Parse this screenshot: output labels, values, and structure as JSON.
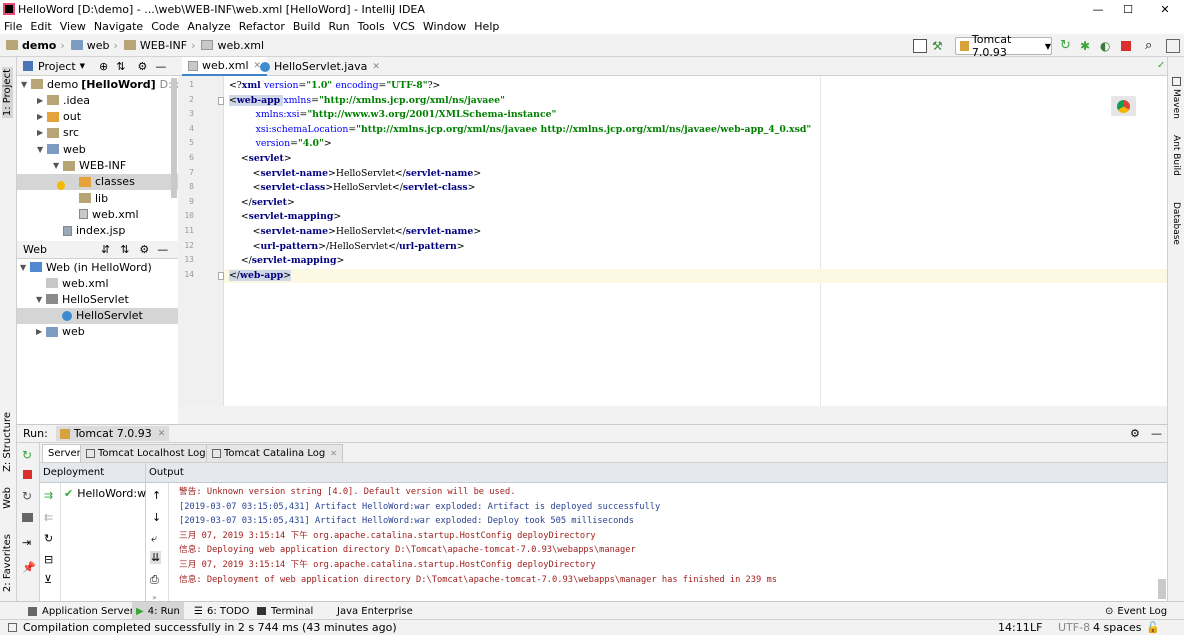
{
  "window": {
    "title": "HelloWord [D:\\demo] - ...\\web\\WEB-INF\\web.xml [HelloWord] - IntelliJ IDEA",
    "controls": {
      "minimize": "—",
      "maximize": "☐",
      "close": "✕"
    }
  },
  "menu": [
    "File",
    "Edit",
    "View",
    "Navigate",
    "Code",
    "Analyze",
    "Refactor",
    "Build",
    "Run",
    "Tools",
    "VCS",
    "Window",
    "Help"
  ],
  "breadcrumb": [
    "demo",
    "web",
    "WEB-INF",
    "web.xml"
  ],
  "run_config": {
    "label": "Tomcat 7.0.93"
  },
  "left_tool_windows": {
    "project": "1: Project",
    "structure": "Z: Structure",
    "web": "Web",
    "favorites": "2: Favorites"
  },
  "right_tool_windows": [
    "Maven",
    "Ant Build",
    "Database"
  ],
  "project_panel": {
    "title": "Project",
    "tree": [
      {
        "label": "demo",
        "bold_suffix": "[HelloWord]",
        "suffix": "D:\\demo",
        "level": 0,
        "expanded": true,
        "icon": "folder-icon"
      },
      {
        "label": ".idea",
        "level": 1,
        "expanded": false,
        "icon": "folder-icon"
      },
      {
        "label": "out",
        "level": 1,
        "expanded": false,
        "icon": "folder-orange-icon"
      },
      {
        "label": "src",
        "level": 1,
        "expanded": false,
        "icon": "folder-icon"
      },
      {
        "label": "web",
        "level": 1,
        "expanded": true,
        "icon": "folder-blue-icon"
      },
      {
        "label": "WEB-INF",
        "level": 2,
        "expanded": true,
        "icon": "folder-icon"
      },
      {
        "label": "classes",
        "level": 3,
        "expanded": null,
        "icon": "folder-orange-icon",
        "selected": true
      },
      {
        "label": "lib",
        "level": 3,
        "expanded": null,
        "icon": "folder-icon"
      },
      {
        "label": "web.xml",
        "level": 3,
        "expanded": null,
        "icon": "xml-file-icon"
      },
      {
        "label": "index.jsp",
        "level": 2,
        "expanded": null,
        "icon": "jsp-file-icon"
      }
    ]
  },
  "web_panel": {
    "title": "Web",
    "tree": [
      {
        "label": "Web (in HelloWord)",
        "level": 0,
        "expanded": true,
        "icon": "web-icon"
      },
      {
        "label": "web.xml",
        "level": 1,
        "expanded": null,
        "icon": "xml-file-icon"
      },
      {
        "label": "HelloServlet",
        "level": 1,
        "expanded": true,
        "icon": "servlet-icon"
      },
      {
        "label": "HelloServlet",
        "level": 2,
        "expanded": null,
        "icon": "class-icon",
        "selected": true
      },
      {
        "label": "web",
        "level": 1,
        "expanded": false,
        "icon": "folder-blue-icon"
      }
    ]
  },
  "editor": {
    "tabs": [
      {
        "label": "web.xml",
        "active": true
      },
      {
        "label": "HelloServlet.java",
        "active": false
      }
    ],
    "line_numbers": [
      "1",
      "2",
      "3",
      "4",
      "5",
      "6",
      "7",
      "8",
      "9",
      "10",
      "11",
      "12",
      "13",
      "14"
    ],
    "code_lines": [
      [
        {
          "t": "br",
          "v": "<?"
        },
        {
          "t": "tag",
          "v": "xml "
        },
        {
          "t": "attr",
          "v": "version"
        },
        {
          "t": "br",
          "v": "="
        },
        {
          "t": "val",
          "v": "\"1.0\" "
        },
        {
          "t": "attr",
          "v": "encoding"
        },
        {
          "t": "br",
          "v": "="
        },
        {
          "t": "val",
          "v": "\"UTF-8\""
        },
        {
          "t": "br",
          "v": "?>"
        }
      ],
      [
        {
          "t": "br",
          "v": "<"
        },
        {
          "t": "tag",
          "v": "web-app "
        },
        {
          "t": "attr",
          "v": "xmlns"
        },
        {
          "t": "br",
          "v": "="
        },
        {
          "t": "val",
          "v": "\"http://xmlns.jcp.org/xml/ns/javaee\""
        }
      ],
      [
        {
          "t": "txt",
          "v": "         "
        },
        {
          "t": "attr",
          "v": "xmlns:xsi"
        },
        {
          "t": "br",
          "v": "="
        },
        {
          "t": "val",
          "v": "\"http://www.w3.org/2001/XMLSchema-instance\""
        }
      ],
      [
        {
          "t": "txt",
          "v": "         "
        },
        {
          "t": "attr",
          "v": "xsi:schemaLocation"
        },
        {
          "t": "br",
          "v": "="
        },
        {
          "t": "val",
          "v": "\"http://xmlns.jcp.org/xml/ns/javaee http://xmlns.jcp.org/xml/ns/javaee/web-app_4_0.xsd\""
        }
      ],
      [
        {
          "t": "txt",
          "v": "         "
        },
        {
          "t": "attr",
          "v": "version"
        },
        {
          "t": "br",
          "v": "="
        },
        {
          "t": "val",
          "v": "\"4.0\""
        },
        {
          "t": "br",
          "v": ">"
        }
      ],
      [
        {
          "t": "txt",
          "v": "    "
        },
        {
          "t": "br",
          "v": "<"
        },
        {
          "t": "tag",
          "v": "servlet"
        },
        {
          "t": "br",
          "v": ">"
        }
      ],
      [
        {
          "t": "txt",
          "v": "        "
        },
        {
          "t": "br",
          "v": "<"
        },
        {
          "t": "tag",
          "v": "servlet-name"
        },
        {
          "t": "br",
          "v": ">"
        },
        {
          "t": "txt",
          "v": "HelloServlet"
        },
        {
          "t": "br",
          "v": "</"
        },
        {
          "t": "tag",
          "v": "servlet-name"
        },
        {
          "t": "br",
          "v": ">"
        }
      ],
      [
        {
          "t": "txt",
          "v": "        "
        },
        {
          "t": "br",
          "v": "<"
        },
        {
          "t": "tag",
          "v": "servlet-class"
        },
        {
          "t": "br",
          "v": ">"
        },
        {
          "t": "txt",
          "v": "HelloServlet"
        },
        {
          "t": "br",
          "v": "</"
        },
        {
          "t": "tag",
          "v": "servlet-class"
        },
        {
          "t": "br",
          "v": ">"
        }
      ],
      [
        {
          "t": "txt",
          "v": "    "
        },
        {
          "t": "br",
          "v": "</"
        },
        {
          "t": "tag",
          "v": "servlet"
        },
        {
          "t": "br",
          "v": ">"
        }
      ],
      [
        {
          "t": "txt",
          "v": "    "
        },
        {
          "t": "br",
          "v": "<"
        },
        {
          "t": "tag",
          "v": "servlet-mapping"
        },
        {
          "t": "br",
          "v": ">"
        }
      ],
      [
        {
          "t": "txt",
          "v": "        "
        },
        {
          "t": "br",
          "v": "<"
        },
        {
          "t": "tag",
          "v": "servlet-name"
        },
        {
          "t": "br",
          "v": ">"
        },
        {
          "t": "txt",
          "v": "HelloServlet"
        },
        {
          "t": "br",
          "v": "</"
        },
        {
          "t": "tag",
          "v": "servlet-name"
        },
        {
          "t": "br",
          "v": ">"
        }
      ],
      [
        {
          "t": "txt",
          "v": "        "
        },
        {
          "t": "br",
          "v": "<"
        },
        {
          "t": "tag",
          "v": "url-pattern"
        },
        {
          "t": "br",
          "v": ">"
        },
        {
          "t": "txt",
          "v": "/HelloServlet"
        },
        {
          "t": "br",
          "v": "</"
        },
        {
          "t": "tag",
          "v": "url-pattern"
        },
        {
          "t": "br",
          "v": ">"
        }
      ],
      [
        {
          "t": "txt",
          "v": "    "
        },
        {
          "t": "br",
          "v": "</"
        },
        {
          "t": "tag",
          "v": "servlet-mapping"
        },
        {
          "t": "br",
          "v": ">"
        }
      ],
      [
        {
          "t": "br",
          "v": "</"
        },
        {
          "t": "tag",
          "v": "web-app"
        },
        {
          "t": "br",
          "v": ">"
        }
      ]
    ]
  },
  "run_panel": {
    "label": "Run:",
    "config_tab": "Tomcat 7.0.93",
    "tabs": [
      "Server",
      "Tomcat Localhost Log",
      "Tomcat Catalina Log"
    ],
    "deployment_header": "Deployment",
    "deployment_item": "HelloWord:war",
    "output_header": "Output",
    "output_lines": [
      {
        "text": "警告: Unknown version string [4.0]. Default version will be used.",
        "color": "red"
      },
      {
        "text": "[2019-03-07 03:15:05,431] Artifact HelloWord:war exploded: Artifact is deployed successfully",
        "color": "blue"
      },
      {
        "text": "[2019-03-07 03:15:05,431] Artifact HelloWord:war exploded: Deploy took 505 milliseconds",
        "color": "blue"
      },
      {
        "text": "三月 07, 2019 3:15:14 下午 org.apache.catalina.startup.HostConfig deployDirectory",
        "color": "red"
      },
      {
        "text": "信息: Deploying web application directory D:\\Tomcat\\apache-tomcat-7.0.93\\webapps\\manager",
        "color": "red"
      },
      {
        "text": "三月 07, 2019 3:15:14 下午 org.apache.catalina.startup.HostConfig deployDirectory",
        "color": "red"
      },
      {
        "text": "信息: Deployment of web application directory D:\\Tomcat\\apache-tomcat-7.0.93\\webapps\\manager has finished in 239 ms",
        "color": "red"
      }
    ]
  },
  "bottom_tabs": {
    "application_servers": "Application Servers",
    "run": "4: Run",
    "todo": "6: TODO",
    "terminal": "Terminal",
    "java_enterprise": "Java Enterprise",
    "event_log": "Event Log"
  },
  "status": {
    "message": "Compilation completed successfully in 2 s 744 ms (43 minutes ago)",
    "position": "14:11",
    "line_sep": "LF",
    "encoding": "UTF-8",
    "indent": "4 spaces"
  },
  "colors": {
    "selection": "#cfd8e6",
    "tag": "#000080",
    "attr": "#0000ff",
    "value": "#008000",
    "error_text": "#a0211e",
    "info_text": "#2b4494"
  }
}
